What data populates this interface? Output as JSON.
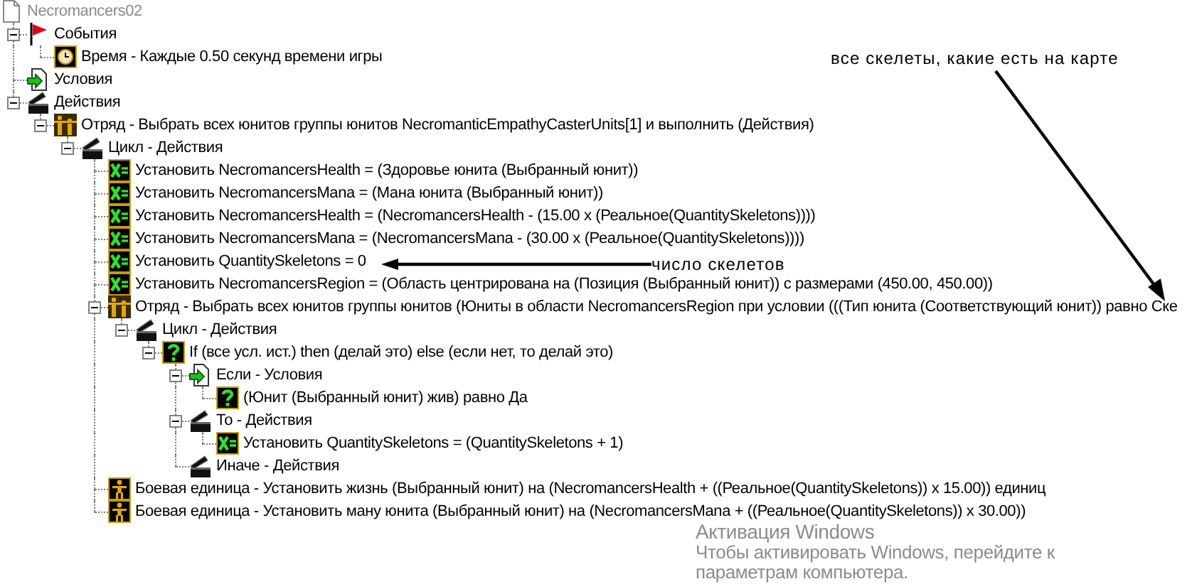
{
  "tree": {
    "label": "Necromancers02",
    "kind": "trigger",
    "children": [
      {
        "label": "События",
        "kind": "flag",
        "expanded": true,
        "children": [
          {
            "label": "Время - Каждые 0.50 секунд времени игры",
            "kind": "clock"
          }
        ]
      },
      {
        "label": "Условия",
        "kind": "conditions"
      },
      {
        "label": "Действия",
        "kind": "actions",
        "expanded": true,
        "children": [
          {
            "label": "Отряд - Выбрать всех юнитов группы юнитов NecromanticEmpathyCasterUnits[1] и выполнить (Действия)",
            "kind": "group",
            "expanded": true,
            "children": [
              {
                "label": "Цикл - Действия",
                "kind": "actions",
                "expanded": true,
                "children": [
                  {
                    "label": "Установить NecromancersHealth = (Здоровье юнита (Выбранный юнит))",
                    "kind": "set"
                  },
                  {
                    "label": "Установить NecromancersMana = (Мана юнита (Выбранный юнит))",
                    "kind": "set"
                  },
                  {
                    "label": "Установить NecromancersHealth = (NecromancersHealth - (15.00 x (Реальное(QuantitySkeletons))))",
                    "kind": "set"
                  },
                  {
                    "label": "Установить NecromancersMana = (NecromancersMana - (30.00 x (Реальное(QuantitySkeletons))))",
                    "kind": "set"
                  },
                  {
                    "label": "Установить QuantitySkeletons = 0",
                    "kind": "set"
                  },
                  {
                    "label": "Установить NecromancersRegion = (Область центрирована на (Позиция (Выбранный юнит)) с размерами (450.00, 450.00))",
                    "kind": "set"
                  },
                  {
                    "label": "Отряд - Выбрать всех юнитов группы юнитов (Юниты в области NecromancersRegion при условии (((Тип юнита (Соответствующий юнит)) равно Ске",
                    "kind": "group",
                    "expanded": true,
                    "children": [
                      {
                        "label": "Цикл - Действия",
                        "kind": "actions",
                        "expanded": true,
                        "children": [
                          {
                            "label": "If (все усл. ист.) then (делай это) else (если нет, то делай это)",
                            "kind": "question",
                            "expanded": true,
                            "children": [
                              {
                                "label": "Если - Условия",
                                "kind": "conditions",
                                "expanded": true,
                                "children": [
                                  {
                                    "label": "(Юнит (Выбранный юнит) жив) равно Да",
                                    "kind": "question"
                                  }
                                ]
                              },
                              {
                                "label": "То - Действия",
                                "kind": "actions",
                                "expanded": true,
                                "children": [
                                  {
                                    "label": "Установить QuantitySkeletons = (QuantitySkeletons + 1)",
                                    "kind": "set"
                                  }
                                ]
                              },
                              {
                                "label": "Иначе - Действия",
                                "kind": "actions"
                              }
                            ]
                          }
                        ]
                      }
                    ]
                  },
                  {
                    "label": "Боевая единица - Установить жизнь (Выбранный юнит) на (NecromancersHealth + ((Реальное(QuantitySkeletons)) x 15.00)) единиц",
                    "kind": "unit"
                  },
                  {
                    "label": "Боевая единица - Установить ману юнита (Выбранный юнит) на (NecromancersMana + ((Реальное(QuantitySkeletons)) x 30.00))",
                    "kind": "unit"
                  }
                ]
              }
            ]
          }
        ]
      }
    ]
  },
  "annotations": [
    {
      "text": "все скелеты, какие есть на карте",
      "kind": "arrow-down"
    },
    {
      "text": "число скелетов",
      "kind": "arrow-left"
    }
  ],
  "watermark": {
    "title": "Активация Windows",
    "lines": [
      "Чтобы активировать Windows, перейдите к",
      "параметрам компьютера."
    ]
  }
}
